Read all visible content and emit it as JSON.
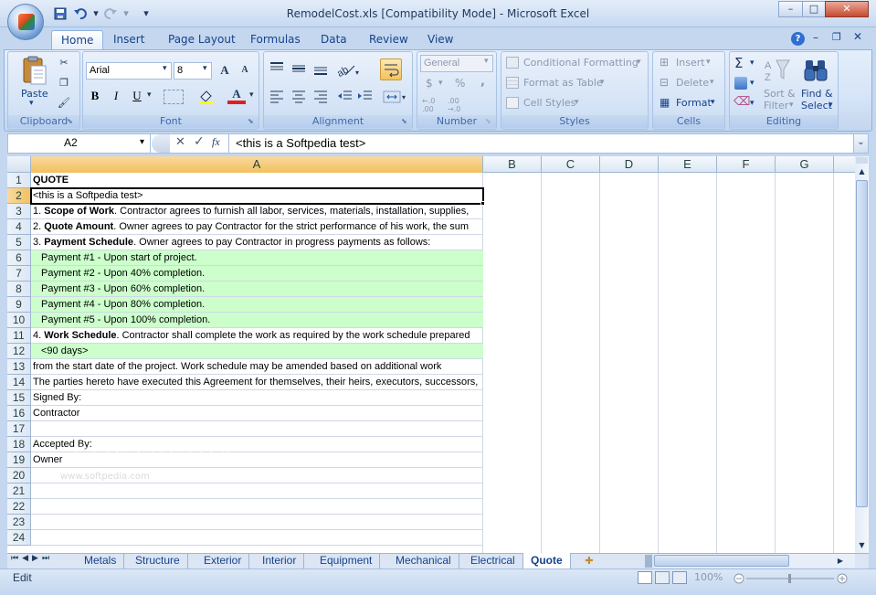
{
  "window": {
    "title": "RemodelCost.xls  [Compatibility Mode] - Microsoft Excel",
    "minimize": "–",
    "maximize": "□",
    "close": "✕"
  },
  "qat": {
    "save_icon": "save-icon",
    "undo_icon": "undo-icon",
    "redo_icon": "redo-icon",
    "customize_icon": "chevron-down-icon"
  },
  "tabs": [
    "Home",
    "Insert",
    "Page Layout",
    "Formulas",
    "Data",
    "Review",
    "View"
  ],
  "active_tab": "Home",
  "ribbon": {
    "clipboard": {
      "paste": "Paste",
      "label": "Clipboard"
    },
    "font": {
      "family": "Arial",
      "size": "8",
      "label": "Font",
      "bold": "B",
      "italic": "I",
      "underline": "U",
      "grow": "A",
      "shrink": "A",
      "color": "A"
    },
    "alignment": {
      "label": "Alignment"
    },
    "number": {
      "format": "General",
      "currency": "$",
      "percent": "%",
      "comma": ",",
      "inc_decimal": "←.0 .00",
      "dec_decimal": ".00 →.0",
      "label": "Number"
    },
    "styles": {
      "conditional": "Conditional Formatting",
      "table": "Format as Table",
      "cell_styles": "Cell Styles",
      "label": "Styles"
    },
    "cells": {
      "insert": "Insert",
      "delete": "Delete",
      "format": "Format",
      "label": "Cells"
    },
    "editing": {
      "sum": "Σ",
      "sort": "Sort &",
      "sort2": "Filter",
      "find": "Find &",
      "find2": "Select",
      "label": "Editing"
    }
  },
  "formula_bar": {
    "name_box": "A2",
    "fx": "fx",
    "content": "<this is a Softpedia test>"
  },
  "columns": [
    "A",
    "B",
    "C",
    "D",
    "E",
    "F",
    "G"
  ],
  "selected_cell": "A2",
  "rows": [
    {
      "n": "1",
      "text": "QUOTE",
      "bold_prefix": "QUOTE",
      "rest": "",
      "green": false,
      "indent": false
    },
    {
      "n": "2",
      "text": "<this is a Softpedia test>",
      "bold_prefix": "",
      "rest": "<this is a Softpedia test>",
      "green": false,
      "indent": false
    },
    {
      "n": "3",
      "text": "1. Scope of Work. Contractor agrees to furnish all labor, services, materials, installation, supplies,",
      "pre": "1. ",
      "bold_prefix": "Scope of Work",
      "rest": ". Contractor agrees to furnish all labor, services, materials, installation, supplies,",
      "green": false,
      "indent": false
    },
    {
      "n": "4",
      "text": "2. Quote Amount. Owner agrees to pay Contractor for the strict performance of his work, the sum",
      "pre": "2. ",
      "bold_prefix": "Quote Amount",
      "rest": ". Owner agrees to pay Contractor for the strict performance of his work, the sum",
      "green": false,
      "indent": false
    },
    {
      "n": "5",
      "text": "3. Payment Schedule. Owner agrees to pay Contractor in progress payments as follows:",
      "pre": "3. ",
      "bold_prefix": "Payment Schedule",
      "rest": ". Owner agrees to pay Contractor in progress payments as follows:",
      "green": false,
      "indent": false
    },
    {
      "n": "6",
      "text": "Payment #1 - Upon start of project.",
      "pre": "",
      "bold_prefix": "",
      "rest": "Payment #1 - Upon start of project.",
      "green": true,
      "indent": true
    },
    {
      "n": "7",
      "text": "Payment #2 - Upon 40% completion.",
      "pre": "",
      "bold_prefix": "",
      "rest": "Payment #2 - Upon 40% completion.",
      "green": true,
      "indent": true
    },
    {
      "n": "8",
      "text": "Payment #3 - Upon 60% completion.",
      "pre": "",
      "bold_prefix": "",
      "rest": "Payment #3 - Upon 60% completion.",
      "green": true,
      "indent": true
    },
    {
      "n": "9",
      "text": "Payment #4 - Upon 80% completion.",
      "pre": "",
      "bold_prefix": "",
      "rest": "Payment #4 - Upon 80% completion.",
      "green": true,
      "indent": true
    },
    {
      "n": "10",
      "text": "Payment #5 - Upon 100% completion.",
      "pre": "",
      "bold_prefix": "",
      "rest": "Payment #5 - Upon 100% completion.",
      "green": true,
      "indent": true
    },
    {
      "n": "11",
      "text": "4. Work Schedule. Contractor shall complete the work as required by the work schedule prepared",
      "pre": "4. ",
      "bold_prefix": "Work Schedule",
      "rest": ". Contractor shall complete the work as required by the work schedule prepared",
      "green": false,
      "indent": false
    },
    {
      "n": "12",
      "text": "<90 days>",
      "pre": "",
      "bold_prefix": "",
      "rest": "<90 days>",
      "green": true,
      "indent": true
    },
    {
      "n": "13",
      "text": "from the start date of the project. Work schedule may be amended based on additional work",
      "pre": "",
      "bold_prefix": "",
      "rest": "from the start date of the project. Work schedule may be amended based on additional work",
      "green": false,
      "indent": false
    },
    {
      "n": "14",
      "text": "The parties hereto have executed this Agreement for themselves, their heirs, executors, successors,",
      "pre": "",
      "bold_prefix": "",
      "rest": "The parties hereto have executed this Agreement for themselves, their heirs, executors, successors,",
      "green": false,
      "indent": false
    },
    {
      "n": "15",
      "text": "Signed By:",
      "pre": "",
      "bold_prefix": "",
      "rest": "Signed By:",
      "green": false,
      "indent": false
    },
    {
      "n": "16",
      "text": "Contractor",
      "pre": "",
      "bold_prefix": "",
      "rest": "Contractor",
      "green": false,
      "indent": false
    },
    {
      "n": "17",
      "text": "",
      "pre": "",
      "bold_prefix": "",
      "rest": "",
      "green": false,
      "indent": false
    },
    {
      "n": "18",
      "text": "Accepted By:",
      "pre": "",
      "bold_prefix": "",
      "rest": "Accepted By:",
      "green": false,
      "indent": false
    },
    {
      "n": "19",
      "text": "Owner",
      "pre": "",
      "bold_prefix": "",
      "rest": "Owner",
      "green": false,
      "indent": false
    },
    {
      "n": "20",
      "text": "",
      "pre": "",
      "bold_prefix": "",
      "rest": "",
      "green": false,
      "indent": false
    },
    {
      "n": "21",
      "text": "",
      "pre": "",
      "bold_prefix": "",
      "rest": "",
      "green": false,
      "indent": false
    },
    {
      "n": "22",
      "text": "",
      "pre": "",
      "bold_prefix": "",
      "rest": "",
      "green": false,
      "indent": false
    },
    {
      "n": "23",
      "text": "",
      "pre": "",
      "bold_prefix": "",
      "rest": "",
      "green": false,
      "indent": false
    },
    {
      "n": "24",
      "text": "",
      "pre": "",
      "bold_prefix": "",
      "rest": "",
      "green": false,
      "indent": false
    }
  ],
  "sheet_tabs": [
    "Metals",
    "Structure",
    "Exterior",
    "Interior",
    "Equipment",
    "Mechanical",
    "Electrical",
    "Quote"
  ],
  "active_sheet": "Quote",
  "status": {
    "mode": "Edit",
    "zoom": "100%"
  },
  "watermark": {
    "main": "SOFTPEDIA",
    "url": "www.softpedia.com"
  },
  "colors": {
    "green_fill": "#ccffcc",
    "header_selected": "#f1c15f",
    "ribbon_text": "#15428b"
  }
}
